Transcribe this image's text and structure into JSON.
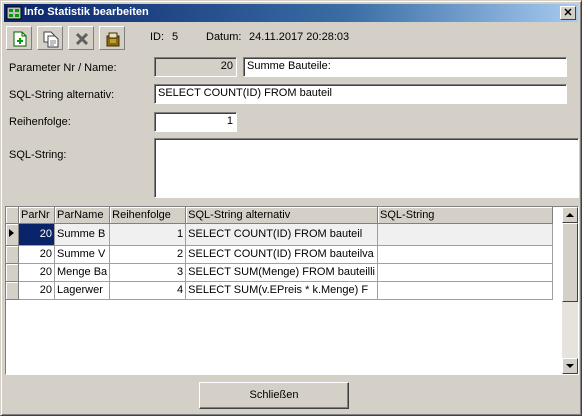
{
  "window": {
    "title": "Info Statistik bearbeiten",
    "close_glyph": "✕"
  },
  "toolbar": {
    "buttons": [
      {
        "icon": "new-record-icon"
      },
      {
        "icon": "copy-record-icon"
      },
      {
        "icon": "delete-icon"
      },
      {
        "icon": "archive-icon"
      }
    ],
    "id_label": "ID:",
    "id_value": "5",
    "datum_label": "Datum:",
    "datum_value": "24.11.2017 20:28:03"
  },
  "form": {
    "param_label": "Parameter Nr / Name:",
    "param_nr": "20",
    "param_name": "Summe Bauteile:",
    "sql_alt_label": "SQL-String alternativ:",
    "sql_alt_value": "SELECT COUNT(ID) FROM bauteil",
    "order_label": "Reihenfolge:",
    "order_value": "1",
    "sql_label": "SQL-String:",
    "sql_value": ""
  },
  "grid": {
    "columns": [
      "ParNr",
      "ParName",
      "Reihenfolge",
      "SQL-String alternativ",
      "SQL-String"
    ],
    "rows": [
      {
        "nr": "20",
        "name": "Summe B",
        "order": "1",
        "sql_alt": "SELECT COUNT(ID) FROM bauteil",
        "sql": ""
      },
      {
        "nr": "20",
        "name": "Summe V",
        "order": "2",
        "sql_alt": "SELECT COUNT(ID) FROM bauteilva",
        "sql": ""
      },
      {
        "nr": "20",
        "name": "Menge Ba",
        "order": "3",
        "sql_alt": "SELECT SUM(Menge) FROM bauteilli",
        "sql": ""
      },
      {
        "nr": "20",
        "name": "Lagerwer",
        "order": "4",
        "sql_alt": "SELECT SUM(v.EPreis * k.Menge) F",
        "sql": ""
      }
    ]
  },
  "footer": {
    "close_label": "Schließen"
  },
  "colors": {
    "titlebar_start": "#0a246a",
    "titlebar_end": "#a6caf0",
    "face": "#d4d0c8",
    "selection": "#0a246a"
  }
}
